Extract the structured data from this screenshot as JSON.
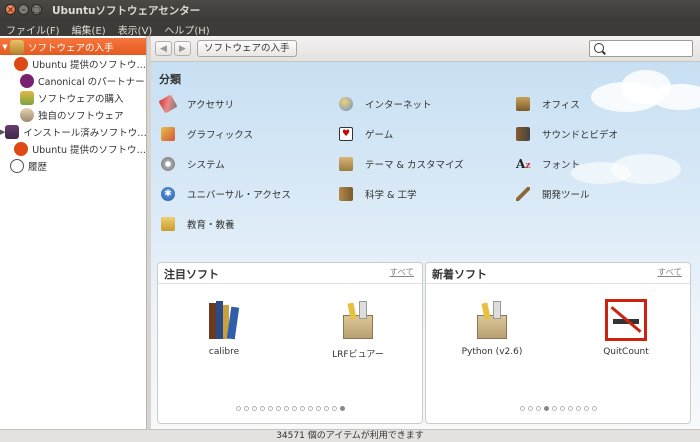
{
  "window": {
    "title": "Ubuntuソフトウェアセンター"
  },
  "menu": [
    "ファイル(F)",
    "編集(E)",
    "表示(V)",
    "ヘルプ(H)"
  ],
  "sidebar": [
    {
      "label": "ソフトウェアの入手",
      "level": 0,
      "selected": true,
      "expander": "▼",
      "icon": "shopping-bag-icon"
    },
    {
      "label": "Ubuntu 提供のソフトウ…",
      "level": 1,
      "icon": "ubuntu-logo-icon"
    },
    {
      "label": "Canonical のパートナー",
      "level": 1,
      "icon": "canonical-icon"
    },
    {
      "label": "ソフトウェアの購入",
      "level": 1,
      "icon": "purchase-icon"
    },
    {
      "label": "独自のソフトウェア",
      "level": 1,
      "icon": "user-icon"
    },
    {
      "label": "インストール済みソフトウ…",
      "level": 0,
      "expander": "▶",
      "icon": "computer-icon"
    },
    {
      "label": "Ubuntu 提供のソフトウ…",
      "level": 1,
      "icon": "ubuntu-logo-icon"
    },
    {
      "label": "履歴",
      "level": 0,
      "icon": "history-clock-icon"
    }
  ],
  "toolbar": {
    "back": "◀",
    "forward": "▶",
    "breadcrumb": "ソフトウェアの入手",
    "search_placeholder": ""
  },
  "categories": {
    "title": "分類",
    "items": [
      {
        "label": "アクセサリ",
        "icon": "accessories-icon"
      },
      {
        "label": "インターネット",
        "icon": "internet-globe-icon"
      },
      {
        "label": "オフィス",
        "icon": "office-icon"
      },
      {
        "label": "グラフィックス",
        "icon": "graphics-icon"
      },
      {
        "label": "ゲーム",
        "icon": "games-cards-icon"
      },
      {
        "label": "サウンドとビデオ",
        "icon": "sound-video-icon"
      },
      {
        "label": "システム",
        "icon": "system-gear-icon"
      },
      {
        "label": "テーマ & カスタマイズ",
        "icon": "themes-icon"
      },
      {
        "label": "フォント",
        "icon": "fonts-icon"
      },
      {
        "label": "ユニバーサル・アクセス",
        "icon": "universal-access-icon"
      },
      {
        "label": "科学 & 工学",
        "icon": "science-icon"
      },
      {
        "label": "開発ツール",
        "icon": "developer-tools-icon"
      },
      {
        "label": "教育・教養",
        "icon": "education-icon"
      }
    ]
  },
  "featured": {
    "title": "注目ソフト",
    "all_link": "すべて",
    "apps": [
      {
        "name": "calibre",
        "icon": "calibre-books-icon"
      },
      {
        "name": "LRFビュアー",
        "icon": "package-box-icon"
      }
    ],
    "dots": 14,
    "active_dot": 13
  },
  "new": {
    "title": "新着ソフト",
    "all_link": "すべて",
    "apps": [
      {
        "name": "Python (v2.6)",
        "icon": "package-box-icon"
      },
      {
        "name": "QuitCount",
        "icon": "no-smoking-icon"
      }
    ],
    "dots": 10,
    "active_dot": 3
  },
  "status": {
    "text": "34571 個のアイテムが利用できます"
  },
  "colors": {
    "accent": "#e4591e",
    "sidebar_selected": "#f07039"
  }
}
